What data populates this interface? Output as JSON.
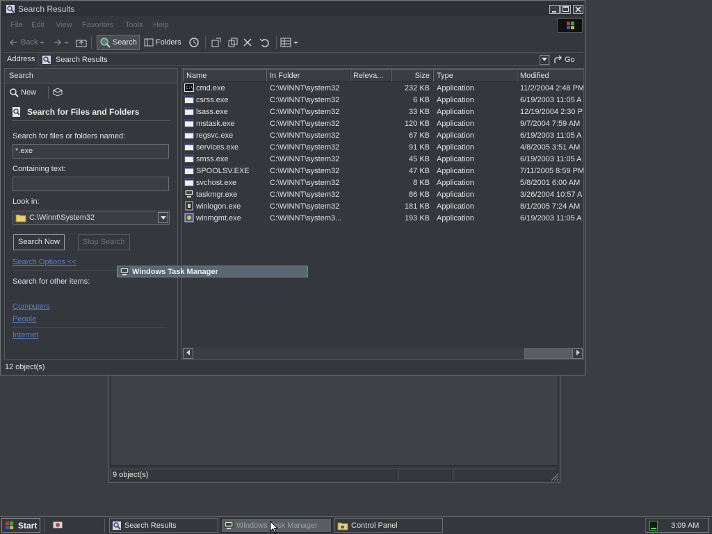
{
  "main_window": {
    "title": "Search Results",
    "menu": [
      "File",
      "Edit",
      "View",
      "Favorites",
      "Tools",
      "Help"
    ],
    "toolbar": {
      "back": "Back",
      "search": "Search",
      "folders": "Folders"
    },
    "address": {
      "label": "Address",
      "value": "Search Results",
      "go": "Go"
    },
    "status": "12 object(s)"
  },
  "search_pane": {
    "header": "Search",
    "new_label": "New",
    "heading": "Search for Files and Folders",
    "named_label": "Search for files or folders named:",
    "named_value": "*.exe",
    "containing_label": "Containing text:",
    "containing_value": "",
    "look_in_label": "Look in:",
    "look_in_value": "C:\\Winnt\\System32",
    "search_now": "Search Now",
    "stop_search": "Stop Search",
    "search_options": "Search Options <<",
    "other_items_label": "Search for other items:",
    "links": [
      "Computers",
      "People",
      "Internet"
    ]
  },
  "results": {
    "columns": [
      "Name",
      "In Folder",
      "Releva...",
      "Size",
      "Type",
      "Modified"
    ],
    "rows": [
      {
        "name": "cmd.exe",
        "folder": "C:\\WINNT\\system32",
        "size": "232 KB",
        "type": "Application",
        "modified": "11/2/2004 2:48 PM",
        "icon": "cmd-icon"
      },
      {
        "name": "csrss.exe",
        "folder": "C:\\WINNT\\system32",
        "size": "6 KB",
        "type": "Application",
        "modified": "6/19/2003 11:05 A",
        "icon": "app-icon"
      },
      {
        "name": "lsass.exe",
        "folder": "C:\\WINNT\\system32",
        "size": "33 KB",
        "type": "Application",
        "modified": "12/19/2004 2:30 P",
        "icon": "app-icon"
      },
      {
        "name": "mstask.exe",
        "folder": "C:\\WINNT\\system32",
        "size": "120 KB",
        "type": "Application",
        "modified": "9/7/2004 7:59 AM",
        "icon": "app-icon"
      },
      {
        "name": "regsvc.exe",
        "folder": "C:\\WINNT\\system32",
        "size": "67 KB",
        "type": "Application",
        "modified": "6/19/2003 11:05 A",
        "icon": "app-icon"
      },
      {
        "name": "services.exe",
        "folder": "C:\\WINNT\\system32",
        "size": "91 KB",
        "type": "Application",
        "modified": "4/8/2005 3:51 AM",
        "icon": "app-icon"
      },
      {
        "name": "smss.exe",
        "folder": "C:\\WINNT\\system32",
        "size": "45 KB",
        "type": "Application",
        "modified": "6/19/2003 11:05 A",
        "icon": "app-icon"
      },
      {
        "name": "SPOOLSV.EXE",
        "folder": "C:\\WINNT\\system32",
        "size": "47 KB",
        "type": "Application",
        "modified": "7/11/2005 8:59 PM",
        "icon": "app-icon"
      },
      {
        "name": "svchost.exe",
        "folder": "C:\\WINNT\\system32",
        "size": "8 KB",
        "type": "Application",
        "modified": "5/8/2001 6:00 AM",
        "icon": "app-icon"
      },
      {
        "name": "taskmgr.exe",
        "folder": "C:\\WINNT\\system32",
        "size": "86 KB",
        "type": "Application",
        "modified": "3/26/2004 10:57 A",
        "icon": "taskmgr-icon"
      },
      {
        "name": "winlogon.exe",
        "folder": "C:\\WINNT\\system32",
        "size": "181 KB",
        "type": "Application",
        "modified": "8/1/2005 7:24 AM",
        "icon": "winlogon-icon"
      },
      {
        "name": "winmgmt.exe",
        "folder": "C:\\WINNT\\system3...",
        "size": "193 KB",
        "type": "Application",
        "modified": "6/19/2003 11:05 A",
        "icon": "winmgmt-icon"
      }
    ]
  },
  "drag_label": "Windows Task Manager",
  "background_window": {
    "status": "9 object(s)"
  },
  "taskbar": {
    "start": "Start",
    "tasks": [
      "Search Results",
      "Windows Task Manager",
      "Control Panel"
    ],
    "active_task": "Windows Task Manager",
    "clock": "3:09 AM"
  }
}
